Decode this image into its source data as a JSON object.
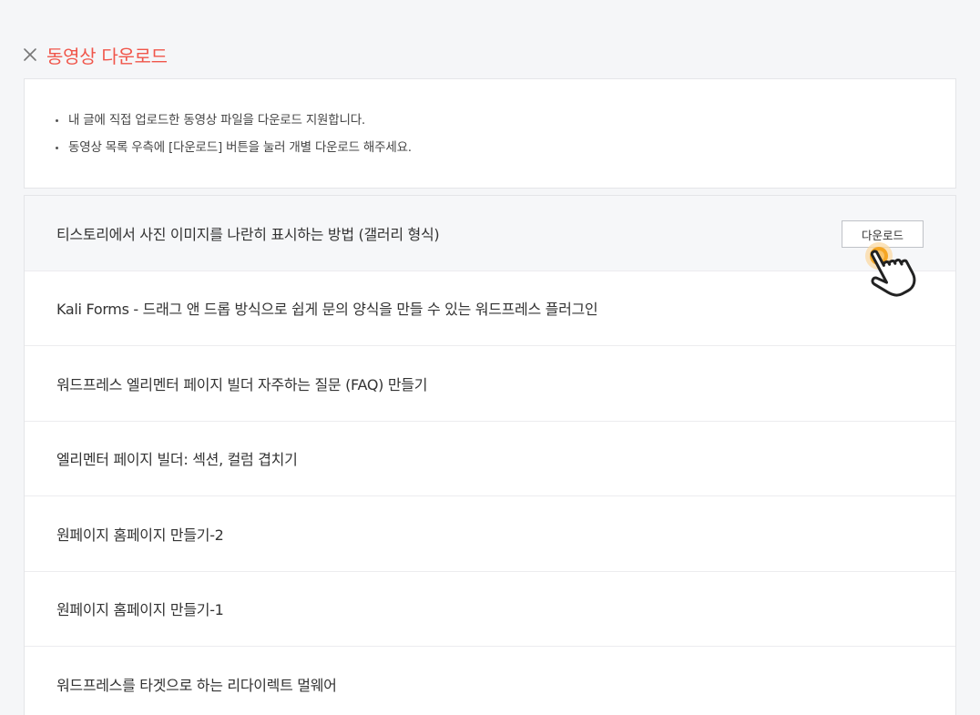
{
  "header": {
    "title": "동영상 다운로드"
  },
  "notice": {
    "items": [
      "내 글에 직접 업로드한 동영상 파일을 다운로드 지원합니다.",
      "동영상 목록 우측에 [다운로드] 버튼을 눌러 개별 다운로드 해주세요."
    ]
  },
  "videos": {
    "download_label": "다운로드",
    "items": [
      "티스토리에서 사진 이미지를 나란히 표시하는 방법 (갤러리 형식)",
      "Kali Forms - 드래그 앤 드롭 방식으로 쉽게 문의 양식을 만들 수 있는 워드프레스 플러그인",
      "워드프레스 엘리멘터 페이지 빌더 자주하는 질문 (FAQ) 만들기",
      "엘리멘터 페이지 빌더: 섹션, 컬럼 겹치기",
      "원페이지 홈페이지 만들기-2",
      "원페이지 홈페이지 만들기-1",
      "워드프레스를 타겟으로 하는 리다이렉트 멀웨어"
    ]
  },
  "colors": {
    "accent": "#f0554a",
    "background": "#f5f6f8",
    "highlight_row": "#f6f7f9",
    "cursor_ring": "#f5a623"
  },
  "icons": {
    "close": "close-icon",
    "cursor": "hand-pointer-icon"
  }
}
